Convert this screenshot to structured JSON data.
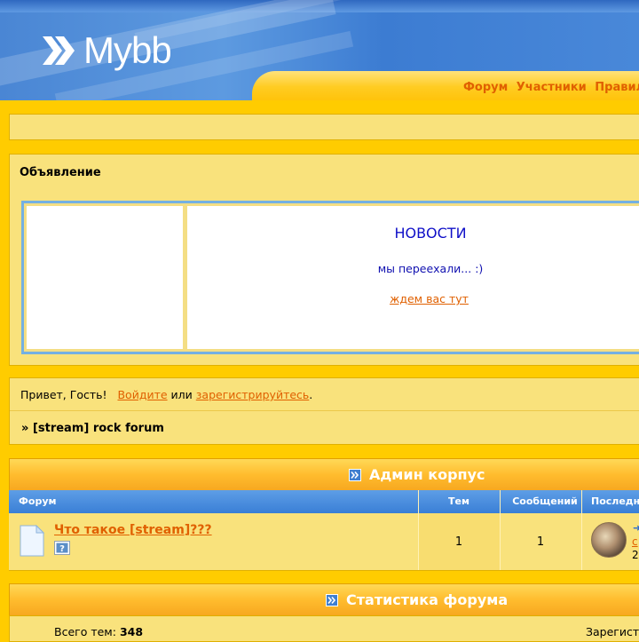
{
  "header": {
    "logo_text": "Mybb",
    "nav": [
      "Форум",
      "Участники",
      "Правила"
    ]
  },
  "announcement": {
    "title": "Объявление",
    "news_title": "НОВОСТИ",
    "news_text": "мы переехали... :)",
    "news_link": "ждем вас тут"
  },
  "welcome": {
    "greeting": "Привет, Гость!",
    "login": "Войдите",
    "or": "или",
    "register": "зарегистрируйтесь",
    "period": "."
  },
  "breadcrumb": {
    "arrow": "»",
    "forum_title": "[stream] rock forum"
  },
  "category": {
    "title": "Админ корпус",
    "columns": {
      "forum": "Форум",
      "topics": "Тем",
      "posts": "Сообщений",
      "last": "Последн"
    },
    "forums": [
      {
        "name": "Что такое [stream]???",
        "topics": "1",
        "posts": "1",
        "last_arrow": "➜",
        "last_link": "с",
        "last_date": "2"
      }
    ]
  },
  "stats": {
    "title": "Статистика форума",
    "topics_label": "Всего тем:",
    "topics_value": "348",
    "registered_label": "Зарегистр"
  },
  "colors": {
    "page_bg": "#ffcc00",
    "panel_bg": "#f9e27c",
    "link": "#e06000",
    "header_blue": "#4a86d4",
    "column_header_blue": "#3a7fd6",
    "news_blue": "#1010c8"
  },
  "icons": {
    "logo": "double-chevron-logo-icon",
    "category": "category-expand-icon",
    "forum": "forum-status-page-icon",
    "subforum": "help-badge-icon"
  }
}
